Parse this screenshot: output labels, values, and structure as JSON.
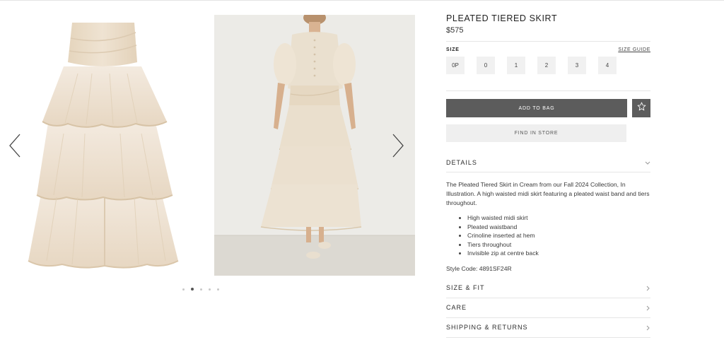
{
  "gallery": {
    "prev_icon": "chevron-left-icon",
    "next_icon": "chevron-right-icon",
    "images": [
      "skirt-product-image",
      "model-wearing-skirt-image"
    ],
    "dots_count": 5,
    "active_dot": 2
  },
  "product": {
    "title": "PLEATED TIERED SKIRT",
    "price": "$575"
  },
  "size": {
    "label": "SIZE",
    "guide_label": "SIZE GUIDE",
    "options": [
      "0P",
      "0",
      "1",
      "2",
      "3",
      "4"
    ]
  },
  "actions": {
    "add_to_bag": "ADD TO BAG",
    "wishlist_icon": "star-icon",
    "find_in_store": "FIND IN STORE"
  },
  "details": {
    "heading": "DETAILS",
    "description": "The Pleated Tiered Skirt in Cream from our Fall 2024 Collection, In Illustration. A high waisted midi skirt featuring a pleated waist band and tiers throughout.",
    "bullets": [
      "High waisted midi skirt",
      "Pleated waistband",
      "Crinoline inserted at hem",
      "Tiers throughout",
      "Invisible zip at centre back"
    ],
    "style_code": "Style Code: 4891SF24R"
  },
  "accordions": [
    "SIZE & FIT",
    "CARE",
    "SHIPPING & RETURNS"
  ],
  "colors": {
    "cream": "#efe4d4",
    "button_dark": "#5c5c5c",
    "button_light": "#efefef",
    "wall": "#ecebe7"
  }
}
